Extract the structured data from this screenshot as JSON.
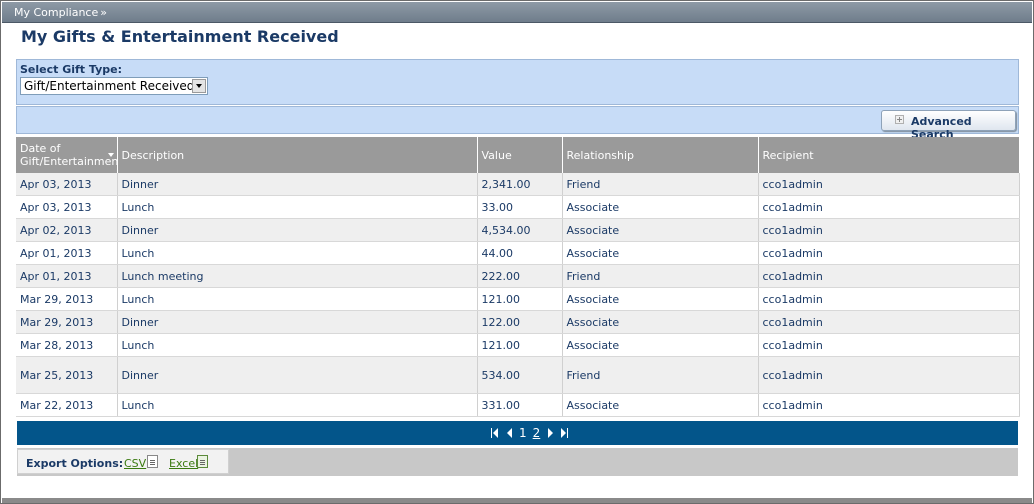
{
  "breadcrumb": {
    "label": "My Compliance",
    "arrow": "»"
  },
  "page": {
    "title": "My Gifts & Entertainment Received"
  },
  "filter": {
    "label": "Select Gift Type:",
    "selected": "Gift/Entertainment Received"
  },
  "toolbar": {
    "advanced_search_label": "Advanced Search"
  },
  "table": {
    "headers": {
      "date": "Date of Gift/Entertainment",
      "description": "Description",
      "value": "Value",
      "relationship": "Relationship",
      "recipient": "Recipient"
    },
    "rows": [
      {
        "date": "Apr 03, 2013",
        "description": "Dinner",
        "value": "2,341.00",
        "relationship": "Friend",
        "recipient": "cco1admin"
      },
      {
        "date": "Apr 03, 2013",
        "description": "Lunch",
        "value": "33.00",
        "relationship": "Associate",
        "recipient": "cco1admin"
      },
      {
        "date": "Apr 02, 2013",
        "description": "Dinner",
        "value": "4,534.00",
        "relationship": "Associate",
        "recipient": "cco1admin"
      },
      {
        "date": "Apr 01, 2013",
        "description": "Lunch",
        "value": "44.00",
        "relationship": "Associate",
        "recipient": "cco1admin"
      },
      {
        "date": "Apr 01, 2013",
        "description": "Lunch meeting",
        "value": "222.00",
        "relationship": "Friend",
        "recipient": "cco1admin"
      },
      {
        "date": "Mar 29, 2013",
        "description": "Lunch",
        "value": "121.00",
        "relationship": "Associate",
        "recipient": "cco1admin"
      },
      {
        "date": "Mar 29, 2013",
        "description": "Dinner",
        "value": "122.00",
        "relationship": "Associate",
        "recipient": "cco1admin"
      },
      {
        "date": "Mar 28, 2013",
        "description": "Lunch",
        "value": "121.00",
        "relationship": "Associate",
        "recipient": "cco1admin"
      },
      {
        "date": "Mar 25, 2013",
        "description": "Dinner",
        "value": "534.00",
        "relationship": "Friend",
        "recipient": "cco1admin"
      },
      {
        "date": "Mar 22, 2013",
        "description": "Lunch",
        "value": "331.00",
        "relationship": "Associate",
        "recipient": "cco1admin"
      }
    ]
  },
  "pager": {
    "page1": "1",
    "page2": "2"
  },
  "export": {
    "label": "Export Options:",
    "csv": "CSV",
    "excel": "Excel"
  },
  "colors": {
    "pager_bg": "#03558a",
    "header_bg": "#9a9a9a",
    "filter_bg": "#c7dcf7",
    "title": "#1b3a66"
  }
}
